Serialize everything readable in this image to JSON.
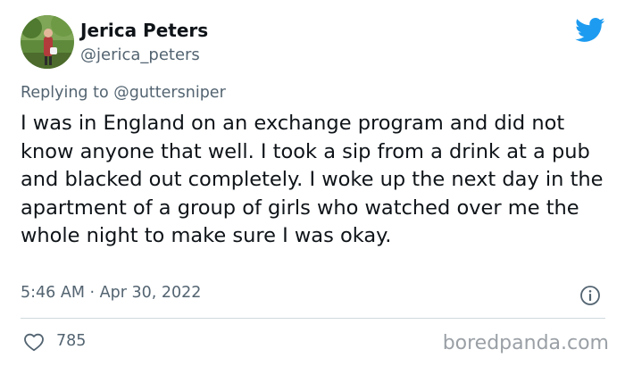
{
  "author": {
    "name": "Jerica Peters",
    "handle": "@jerica_peters"
  },
  "reply": {
    "prefix": "Replying to ",
    "mention": "@guttersniper"
  },
  "tweet": {
    "text": "I was in England on an exchange program and did not know anyone that well. I took a sip from a drink at a pub and blacked out completely. I woke up the next day in the apartment of a group of girls who watched over me the whole night to make sure I was okay.",
    "timestamp": "5:46 AM · Apr 30, 2022",
    "likes": "785"
  },
  "watermark": "boredpanda.com",
  "icons": {
    "brand": "twitter-bird-icon",
    "info": "info-icon",
    "like": "heart-icon"
  },
  "colors": {
    "brand": "#1d9bf0",
    "text": "#0f1419",
    "muted": "#536471"
  }
}
